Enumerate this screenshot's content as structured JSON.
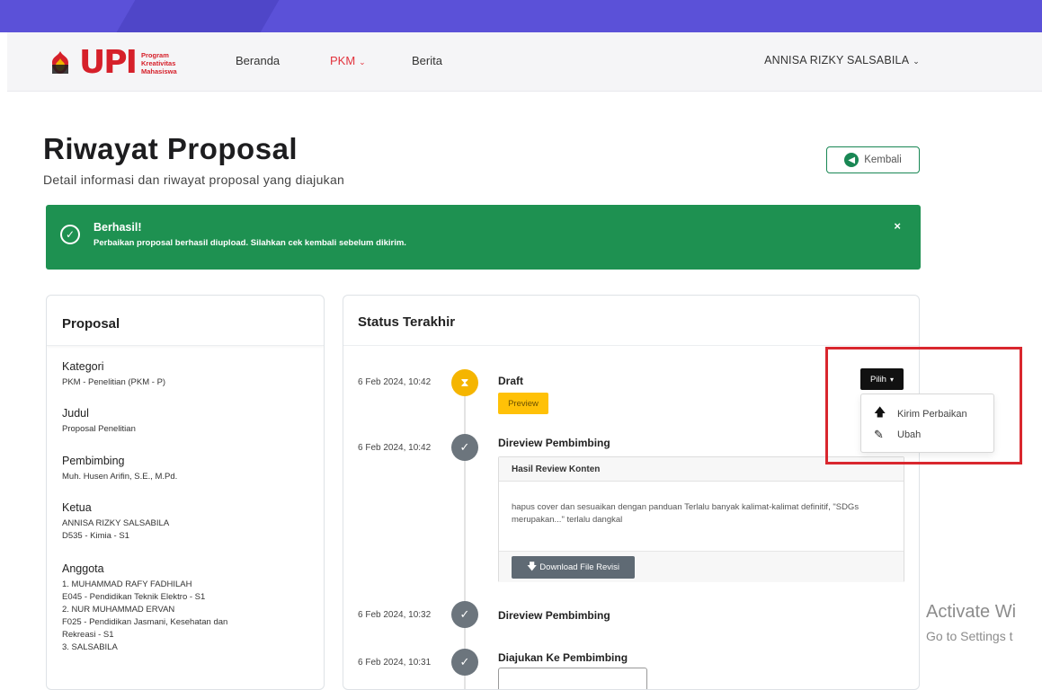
{
  "navbar": {
    "logo_text": "UPI",
    "logo_sub": [
      "Program",
      "Kreativitas",
      "Mahasiswa"
    ],
    "items": [
      {
        "label": "Beranda"
      },
      {
        "label": "PKM",
        "caret": "⌄"
      },
      {
        "label": "Berita"
      }
    ],
    "user": "ANNISA RIZKY SALSABILA",
    "user_caret": "⌄"
  },
  "page": {
    "title": "Riwayat Proposal",
    "subtitle": "Detail informasi dan riwayat proposal yang diajukan",
    "back_label": "Kembali"
  },
  "alert": {
    "title": "Berhasil!",
    "text": "Perbaikan proposal berhasil diupload. Silahkan cek kembali sebelum dikirim.",
    "close": "×"
  },
  "proposal": {
    "header": "Proposal",
    "kategori_label": "Kategori",
    "kategori": "PKM - Penelitian (PKM - P)",
    "judul_label": "Judul",
    "judul": "Proposal Penelitian",
    "pembimbing_label": "Pembimbing",
    "pembimbing": "Muh. Husen Arifin, S.E., M.Pd.",
    "ketua_label": "Ketua",
    "ketua_name": "ANNISA RIZKY SALSABILA",
    "ketua_prodi": "D535 - Kimia - S1",
    "anggota_label": "Anggota",
    "anggota": [
      "1. MUHAMMAD RAFY FADHILAH",
      "E045 - Pendidikan Teknik Elektro - S1",
      "2. NUR MUHAMMAD ERVAN",
      "F025 - Pendidikan Jasmani, Kesehatan dan",
      "Rekreasi - S1",
      "3. SALSABILA"
    ]
  },
  "status": {
    "header": "Status Terakhir",
    "timeline": [
      {
        "date": "6 Feb 2024, 10:42",
        "title": "Draft",
        "icon": "hourglass-icon"
      },
      {
        "date": "6 Feb 2024, 10:42",
        "title": "Direview Pembimbing",
        "icon": "check-icon"
      },
      {
        "date": "6 Feb 2024, 10:32",
        "title": "Direview Pembimbing",
        "icon": "check-icon"
      },
      {
        "date": "6 Feb 2024, 10:31",
        "title": "Diajukan Ke Pembimbing",
        "icon": "check-icon"
      }
    ],
    "preview_label": "Preview",
    "review": {
      "header": "Hasil Review Konten",
      "body": "hapus cover dan sesuaikan dengan panduan Terlalu banyak kalimat-kalimat definitif, \"SDGs merupakan...\" terlalu dangkal",
      "download_label": "Download File Revisi"
    }
  },
  "actions": {
    "pilih_label": "Pilih",
    "pilih_caret": "▾",
    "menu": [
      {
        "label": "Kirim Perbaikan",
        "icon": "arrow-up-icon"
      },
      {
        "label": "Ubah",
        "icon": "edit-icon"
      }
    ]
  },
  "watermark": {
    "line1": "Activate Wi",
    "line2": "Go to Settings t"
  },
  "colors": {
    "top_bar": "#5b51d8",
    "brand_red": "#d6202a",
    "success": "#1e9151",
    "warning": "#ffc107",
    "highlight": "#d9272e"
  }
}
